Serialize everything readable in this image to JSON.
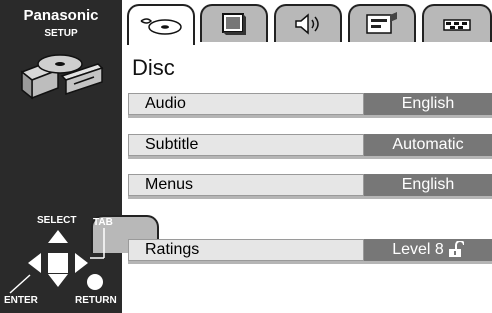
{
  "brand": {
    "name": "Panasonic",
    "subtitle": "SETUP"
  },
  "tabs": [
    {
      "icon": "disc-icon",
      "active": true
    },
    {
      "icon": "screen-icon",
      "active": false
    },
    {
      "icon": "speaker-icon",
      "active": false
    },
    {
      "icon": "display-icon",
      "active": false
    },
    {
      "icon": "other-icon",
      "active": false
    }
  ],
  "page_title": "Disc",
  "rows": [
    {
      "label": "Audio",
      "value": "English"
    },
    {
      "label": "Subtitle",
      "value": "Automatic"
    },
    {
      "label": "Menus",
      "value": "English"
    },
    {
      "label": "Ratings",
      "value": "Level 8",
      "icon": "unlock-icon"
    }
  ],
  "legend": {
    "select": "SELECT",
    "tab": "TAB",
    "enter": "ENTER",
    "return": "RETURN"
  },
  "colors": {
    "sidebar": "#2a2a2a",
    "value_bg": "#777777",
    "label_bg": "#e6e6e6",
    "tab_inactive": "#b8b8b8"
  }
}
